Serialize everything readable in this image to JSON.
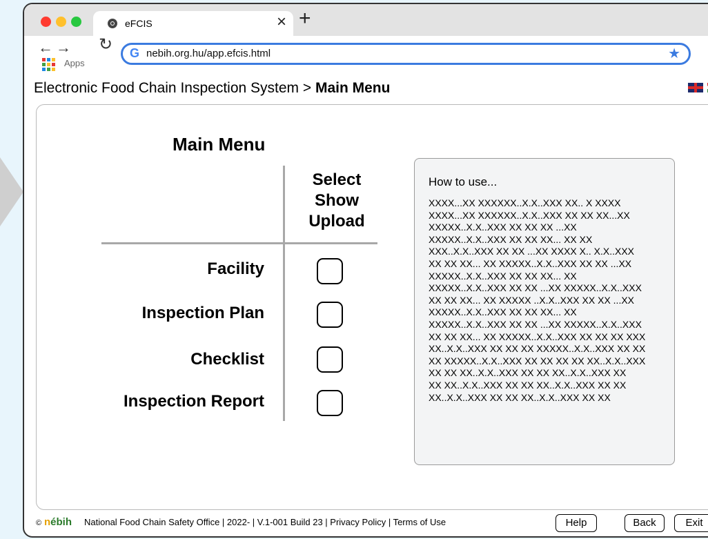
{
  "browser": {
    "tab_title": "eFCIS",
    "new_tab_symbol": "+",
    "close_symbol": "×",
    "apps_label": "Apps",
    "url": "nebih.org.hu/app.efcis.html",
    "star_symbol": "★"
  },
  "header": {
    "breadcrumb_prefix": "Electronic Food Chain Inspection System > ",
    "breadcrumb_current": "Main Menu"
  },
  "main": {
    "title": "Main Menu",
    "column_header": [
      "Select",
      "Show",
      "Upload"
    ],
    "rows": [
      {
        "label": "Facility"
      },
      {
        "label": "Inspection Plan"
      },
      {
        "label": "Checklist"
      },
      {
        "label": "Inspection Report"
      }
    ]
  },
  "howto": {
    "title": "How to use...",
    "lines": [
      "XXXX...XX XXXXXX..X.X..XXX XX.. X XXXX",
      "XXXX...XX XXXXXX..X.X..XXX XX XX XX...XX",
      "XXXXX..X.X..XXX XX XX XX ...XX",
      "XXXXX..X.X..XXX XX XX XX... XX XX",
      "XXX..X.X..XXX XX XX ...XX XXXX X.. X.X..XXX",
      "XX XX XX... XX XXXXX..X.X..XXX XX XX ...XX",
      "XXXXX..X.X..XXX XX XX XX... XX",
      "XXXXX..X.X..XXX XX XX ...XX XXXXX..X.X..XXX",
      "XX XX XX... XX XXXXX ..X.X..XXX XX XX ...XX",
      "XXXXX..X.X..XXX XX XX XX... XX",
      "XXXXX..X.X..XXX XX XX ...XX XXXXX..X.X..XXX",
      "XX XX XX... XX XXXXX..X.X..XXX XX XX XX XXX",
      "XX..X.X..XXX XX XX XX XXXXX..X.X..XXX XX XX",
      "XX XXXXX..X.X..XXX XX XX XX XX XX..X.X..XXX",
      "XX XX  XX..X.X..XXX XX XX  XX..X.X..XXX XX",
      "XX  XX..X.X..XXX XX XX  XX..X.X..XXX XX XX",
      "XX..X.X..XXX XX XX  XX..X.X..XXX XX XX"
    ]
  },
  "footer": {
    "copyright": "©",
    "logo_n": "n",
    "logo_rest": "ébih",
    "text": "National Food Chain Safety Office  |  2022-  |  V.1-001 Build 23  |  Privacy Policy  |  Terms of Use",
    "help_label": "Help",
    "back_label": "Back",
    "exit_label": "Exit"
  }
}
